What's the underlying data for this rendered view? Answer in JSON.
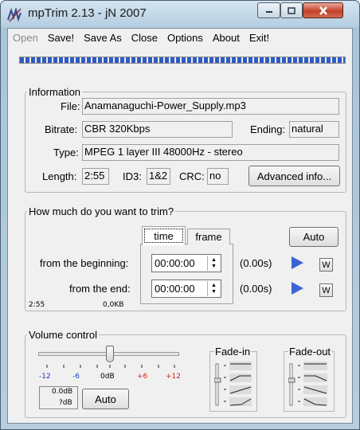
{
  "window": {
    "title": "mpTrim 2.13 - jN 2007"
  },
  "menu": {
    "open": "Open",
    "save": "Save!",
    "save_as": "Save As",
    "close": "Close",
    "options": "Options",
    "about": "About",
    "exit": "Exit!"
  },
  "progress": {
    "fill": 1.0
  },
  "information": {
    "legend": "Information",
    "file_label": "File:",
    "file_value": "Anamanaguchi-Power_Supply.mp3",
    "bitrate_label": "Bitrate:",
    "bitrate_value": "CBR 320Kbps",
    "ending_label": "Ending:",
    "ending_value": "natural",
    "type_label": "Type:",
    "type_value": "MPEG 1 layer III 48000Hz - stereo",
    "length_label": "Length:",
    "length_value": "2:55",
    "id3_label": "ID3:",
    "id3_value": "1&2",
    "crc_label": "CRC:",
    "crc_value": "no",
    "advanced_button": "Advanced info..."
  },
  "trim": {
    "legend": "How much do you want to trim?",
    "tab_time": "time",
    "tab_frame": "frame",
    "auto_button": "Auto",
    "begin_label": "from the beginning:",
    "begin_value": "00:00:00",
    "begin_secs": "(0.00s)",
    "end_label": "from the end:",
    "end_value": "00:00:00",
    "end_secs": "(0.00s)",
    "w_label": "W",
    "footer_length": "2:55",
    "footer_size": "0,0KB"
  },
  "volume": {
    "legend": "Volume control",
    "scale": [
      "-12",
      "-6",
      "0dB",
      "+6",
      "+12"
    ],
    "slider_value_db": 0,
    "readout_db": "0.0dB",
    "readout_q": "?dB",
    "auto_button": "Auto",
    "fade_in_label": "Fade-in",
    "fade_out_label": "Fade-out"
  },
  "colors": {
    "accent_blue": "#2f5bc4",
    "scale_blue": "#1f3fb0",
    "scale_red": "#d0201a",
    "play_blue": "#3a63d6"
  }
}
